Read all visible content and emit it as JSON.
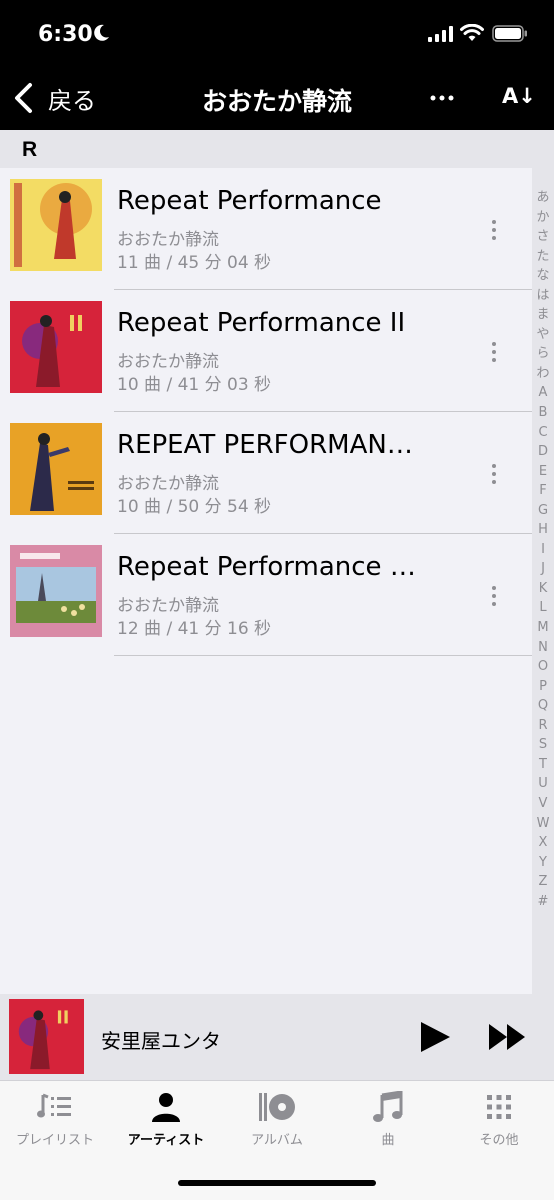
{
  "status": {
    "time": "6:30"
  },
  "nav": {
    "back_label": "戻る",
    "title": "おおたか静流",
    "sort_label": "A↓"
  },
  "section": {
    "letter": "R"
  },
  "albums": [
    {
      "title": "Repeat Performance",
      "artist": "おおたか静流",
      "meta": "11 曲 / 45 分 04 秒",
      "art_icon": "album-art-1"
    },
    {
      "title": "Repeat Performance II",
      "artist": "おおたか静流",
      "meta": "10 曲 / 41 分 03 秒",
      "art_icon": "album-art-2"
    },
    {
      "title": "REPEAT PERFORMANC...",
      "artist": "おおたか静流",
      "meta": "10 曲 / 50 分 54 秒",
      "art_icon": "album-art-3"
    },
    {
      "title": "Repeat Performance V...",
      "artist": "おおたか静流",
      "meta": "12 曲 / 41 分 16 秒",
      "art_icon": "album-art-4"
    }
  ],
  "index": [
    "あ",
    "か",
    "さ",
    "た",
    "な",
    "は",
    "ま",
    "や",
    "ら",
    "わ",
    "A",
    "B",
    "C",
    "D",
    "E",
    "F",
    "G",
    "H",
    "I",
    "J",
    "K",
    "L",
    "M",
    "N",
    "O",
    "P",
    "Q",
    "R",
    "S",
    "T",
    "U",
    "V",
    "W",
    "X",
    "Y",
    "Z",
    "#"
  ],
  "player": {
    "title": "安里屋ユンタ"
  },
  "tabs": [
    {
      "label": "プレイリスト",
      "icon": "playlist-icon",
      "active": false
    },
    {
      "label": "アーティスト",
      "icon": "artist-icon",
      "active": true
    },
    {
      "label": "アルバム",
      "icon": "album-icon",
      "active": false
    },
    {
      "label": "曲",
      "icon": "song-icon",
      "active": false
    },
    {
      "label": "その他",
      "icon": "more-grid-icon",
      "active": false
    }
  ],
  "colors": {
    "accent": "#000000",
    "inactive": "#8e8e93",
    "background": "#f2f2f7"
  }
}
